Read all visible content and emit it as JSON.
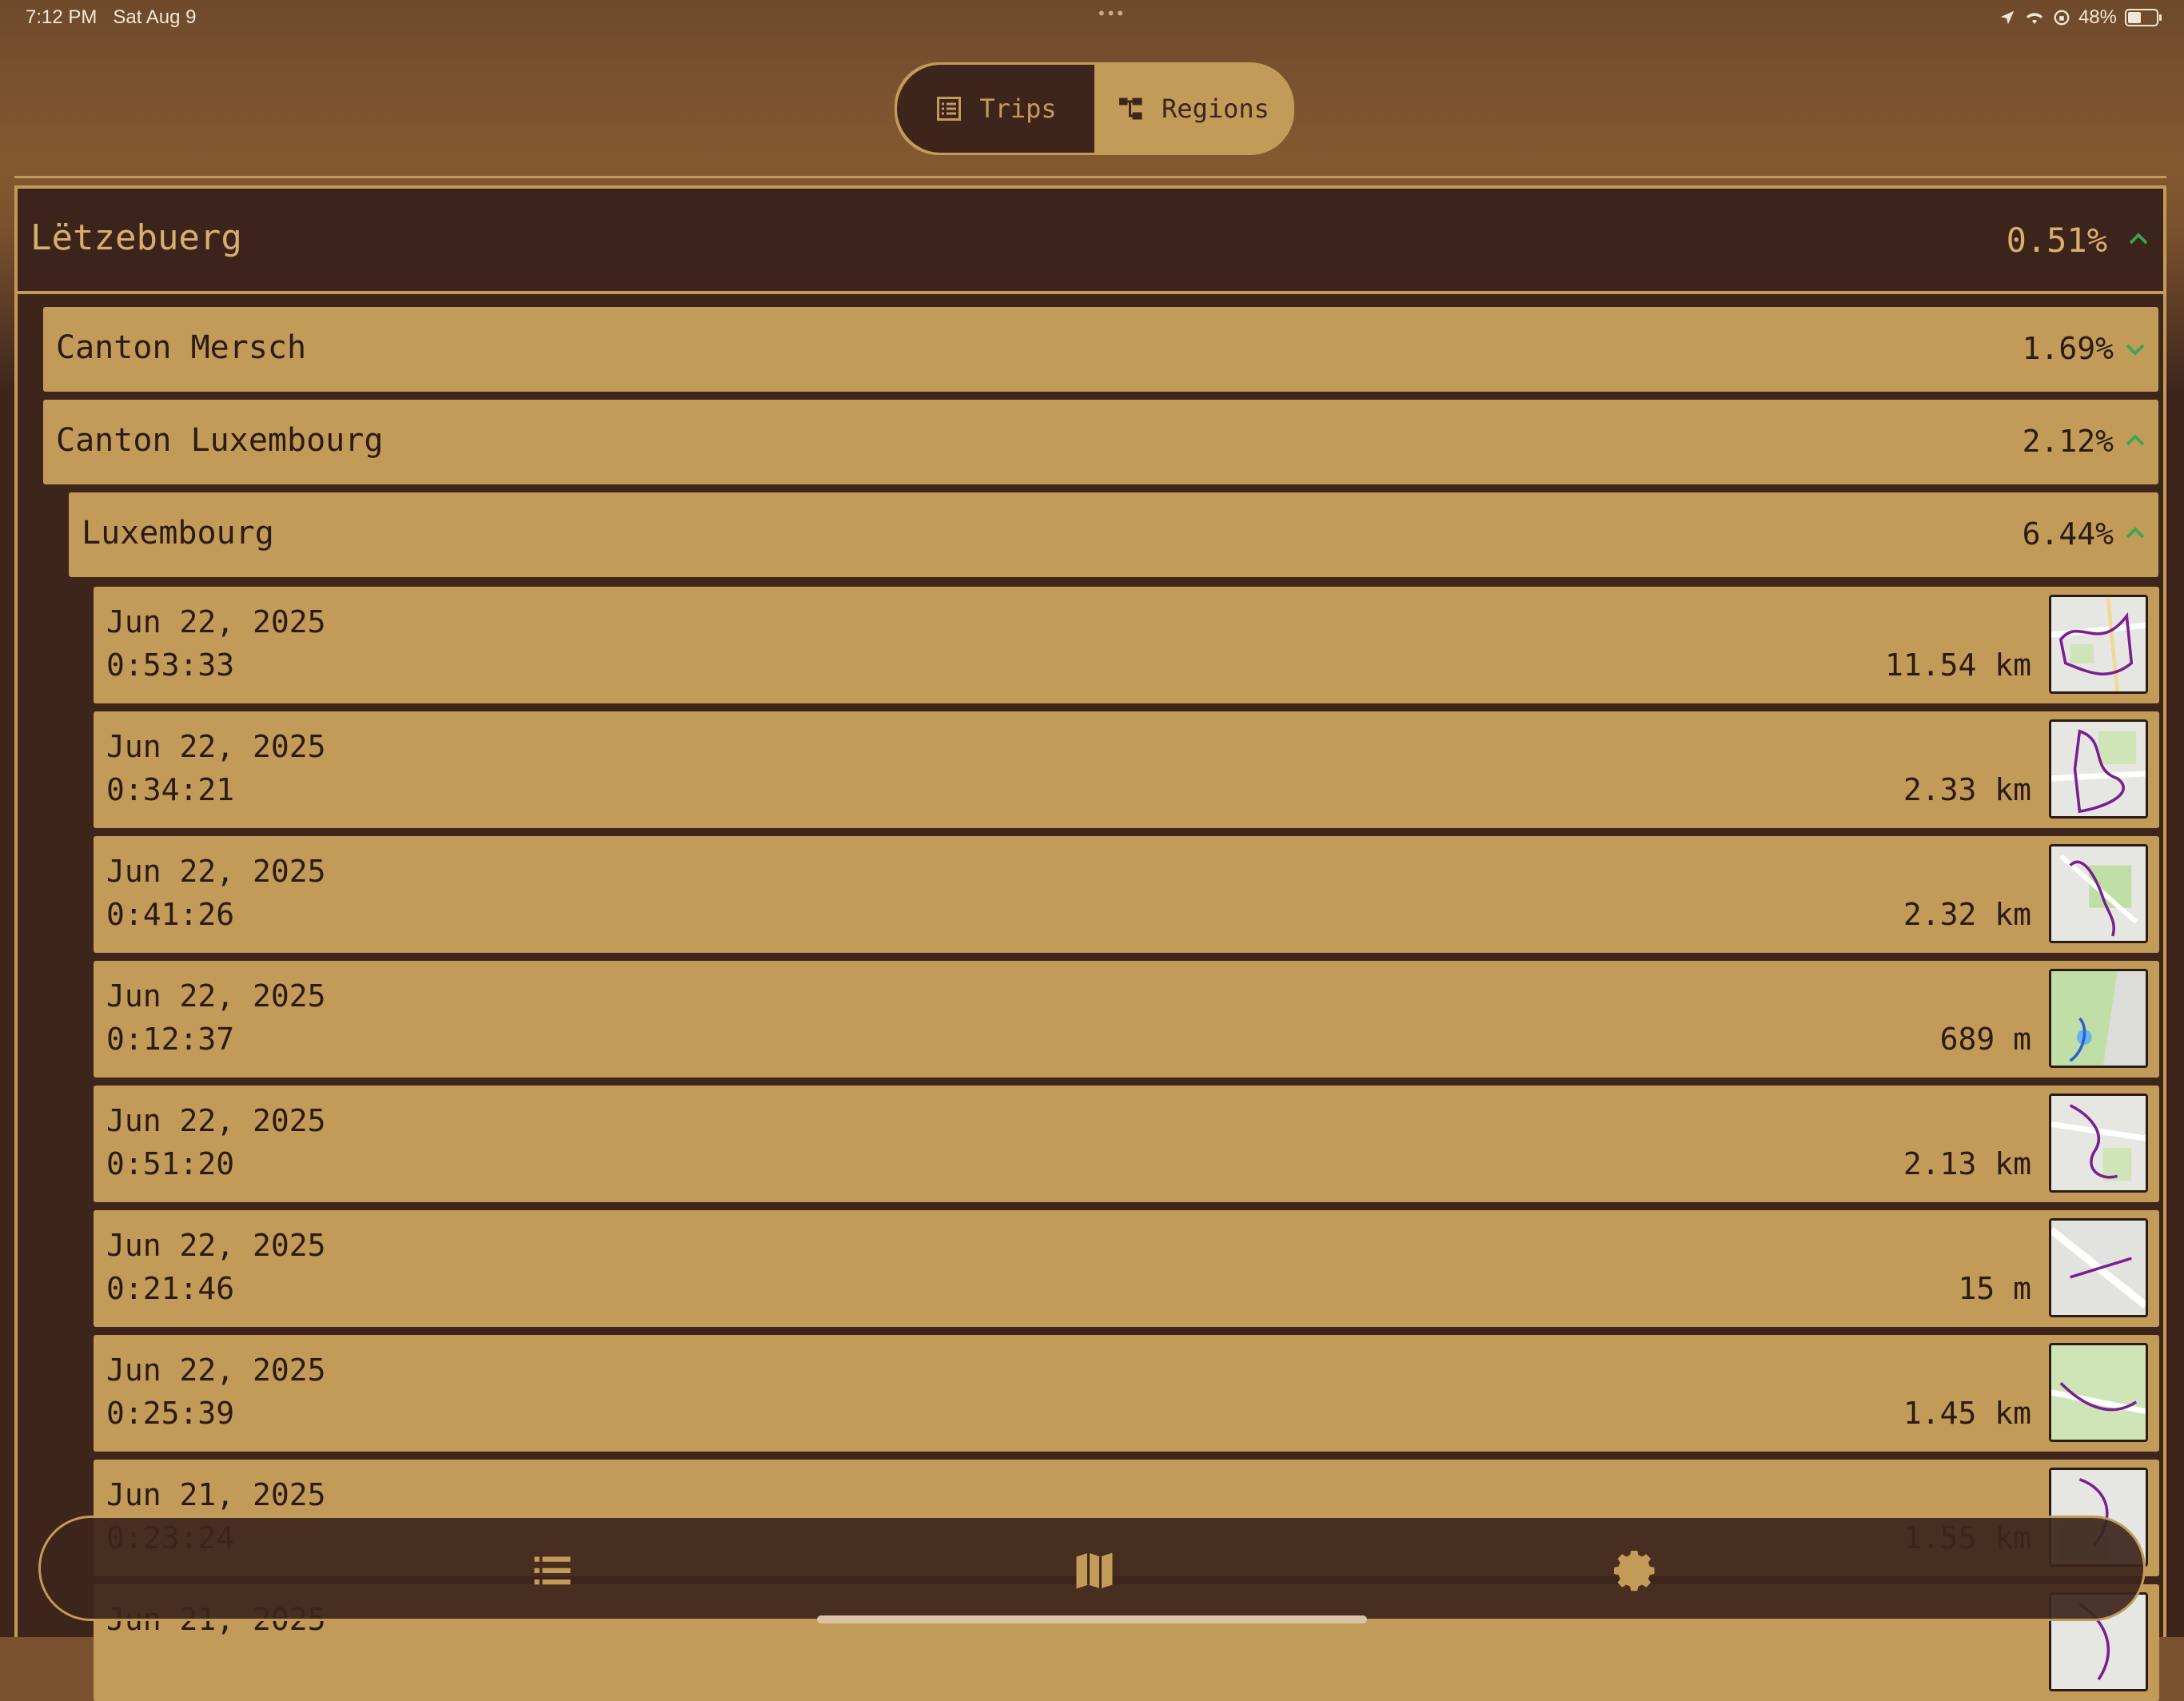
{
  "status_bar": {
    "time": "7:12 PM",
    "date": "Sat Aug 9",
    "battery": "48%",
    "battery_level": 0.48,
    "icons": [
      "location-arrow-icon",
      "wifi-icon",
      "orientation-lock-icon",
      "battery-icon"
    ]
  },
  "segments": [
    {
      "label": "Trips",
      "icon": "list-icon",
      "selected": true
    },
    {
      "label": "Regions",
      "icon": "hierarchy-icon",
      "selected": false
    }
  ],
  "country": {
    "name": "Lëtzebuerg",
    "percent": "0.51%",
    "expanded": true
  },
  "regions": [
    {
      "name": "Canton Mersch",
      "percent": "1.69%",
      "expanded": false
    },
    {
      "name": "Canton Luxembourg",
      "percent": "2.12%",
      "expanded": true
    }
  ],
  "city": {
    "name": "Luxembourg",
    "percent": "6.44%",
    "expanded": true
  },
  "trips": [
    {
      "date": "Jun 22, 2025",
      "duration": "0:53:33",
      "distance": "11.54 km"
    },
    {
      "date": "Jun 22, 2025",
      "duration": "0:34:21",
      "distance": "2.33 km"
    },
    {
      "date": "Jun 22, 2025",
      "duration": "0:41:26",
      "distance": "2.32 km"
    },
    {
      "date": "Jun 22, 2025",
      "duration": "0:12:37",
      "distance": "689 m"
    },
    {
      "date": "Jun 22, 2025",
      "duration": "0:51:20",
      "distance": "2.13 km"
    },
    {
      "date": "Jun 22, 2025",
      "duration": "0:21:46",
      "distance": "15 m"
    },
    {
      "date": "Jun 22, 2025",
      "duration": "0:25:39",
      "distance": "1.45 km"
    },
    {
      "date": "Jun 21, 2025",
      "duration": "0:23:24",
      "distance": "1.55 km"
    },
    {
      "date": "Jun 21, 2025",
      "duration": "",
      "distance": ""
    }
  ],
  "tabbar": {
    "items": [
      "list-icon",
      "map-icon",
      "gear-icon"
    ]
  },
  "colors": {
    "accent": "#c39b58",
    "dark": "#3d251c",
    "chevron": "#3aa655"
  }
}
